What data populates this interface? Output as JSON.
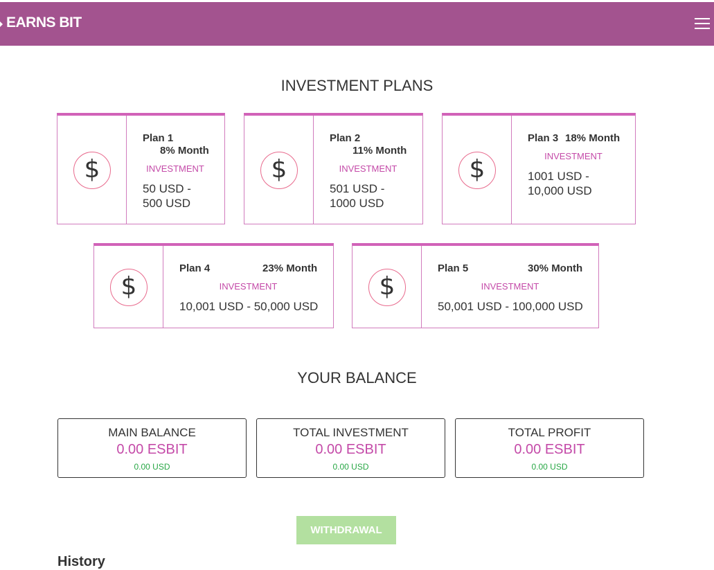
{
  "navbar": {
    "brand": "EARNS BIT",
    "menu_icon": "hamburger-menu-icon",
    "background_color": "#a3538f"
  },
  "plans_section": {
    "title": "INVESTMENT PLANS",
    "plans": [
      {
        "name": "Plan 1",
        "rate": "8% Month",
        "label": "INVESTMENT",
        "range": "50 USD - 500 USD",
        "icon": "dollar-icon",
        "icon_glyph": "$"
      },
      {
        "name": "Plan 2",
        "rate": "11% Month",
        "label": "INVESTMENT",
        "range": "501 USD - 1000 USD",
        "icon": "dollar-icon",
        "icon_glyph": "$"
      },
      {
        "name": "Plan 3",
        "rate": "18% Month",
        "label": "INVESTMENT",
        "range": "1001 USD - 10,000 USD",
        "icon": "dollar-icon",
        "icon_glyph": "$"
      },
      {
        "name": "Plan 4",
        "rate": "23% Month",
        "label": "INVESTMENT",
        "range": "10,001 USD - 50,000 USD",
        "icon": "dollar-icon",
        "icon_glyph": "$"
      },
      {
        "name": "Plan 5",
        "rate": "30% Month",
        "label": "INVESTMENT",
        "range": "50,001 USD - 100,000 USD",
        "icon": "dollar-icon",
        "icon_glyph": "$"
      }
    ]
  },
  "balance_section": {
    "title": "YOUR BALANCE",
    "cards": [
      {
        "title": "MAIN BALANCE",
        "value": "0.00 ESBIT",
        "usd": "0.00 USD"
      },
      {
        "title": "TOTAL INVESTMENT",
        "value": "0.00 ESBIT",
        "usd": "0.00 USD"
      },
      {
        "title": "TOTAL PROFIT",
        "value": "0.00 ESBIT",
        "usd": "0.00 USD"
      }
    ]
  },
  "actions": {
    "withdraw_label": "WITHDRAWAL"
  },
  "history": {
    "title": "History"
  },
  "colors": {
    "accent": "#c44aa8",
    "usd_green": "#28a745",
    "withdraw_button": "#b3e0a0"
  }
}
